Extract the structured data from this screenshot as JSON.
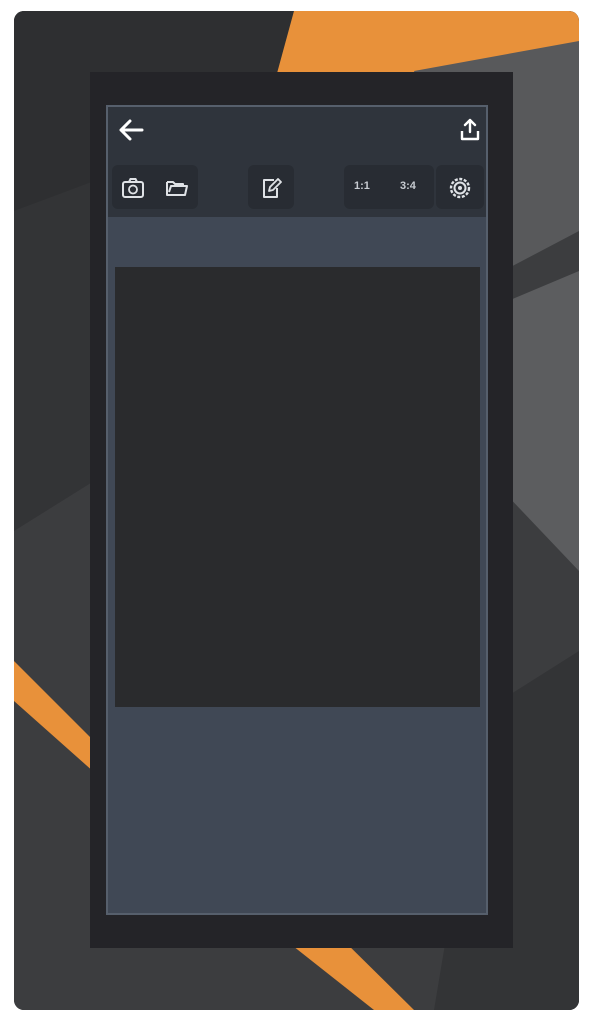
{
  "colors": {
    "accent": "#e8913a",
    "topbar": "#2f343c",
    "screen": "#404855",
    "canvas": "#2a2b2d"
  },
  "toolbar": {
    "back_icon": "arrow-left-icon",
    "share_icon": "share-upload-icon",
    "camera_icon": "camera-switch-icon",
    "folder_icon": "folder-open-icon",
    "edit_icon": "edit-note-icon",
    "settings_icon": "gear-icon",
    "ratio_1_1": "1:1",
    "ratio_3_4": "3:4"
  }
}
